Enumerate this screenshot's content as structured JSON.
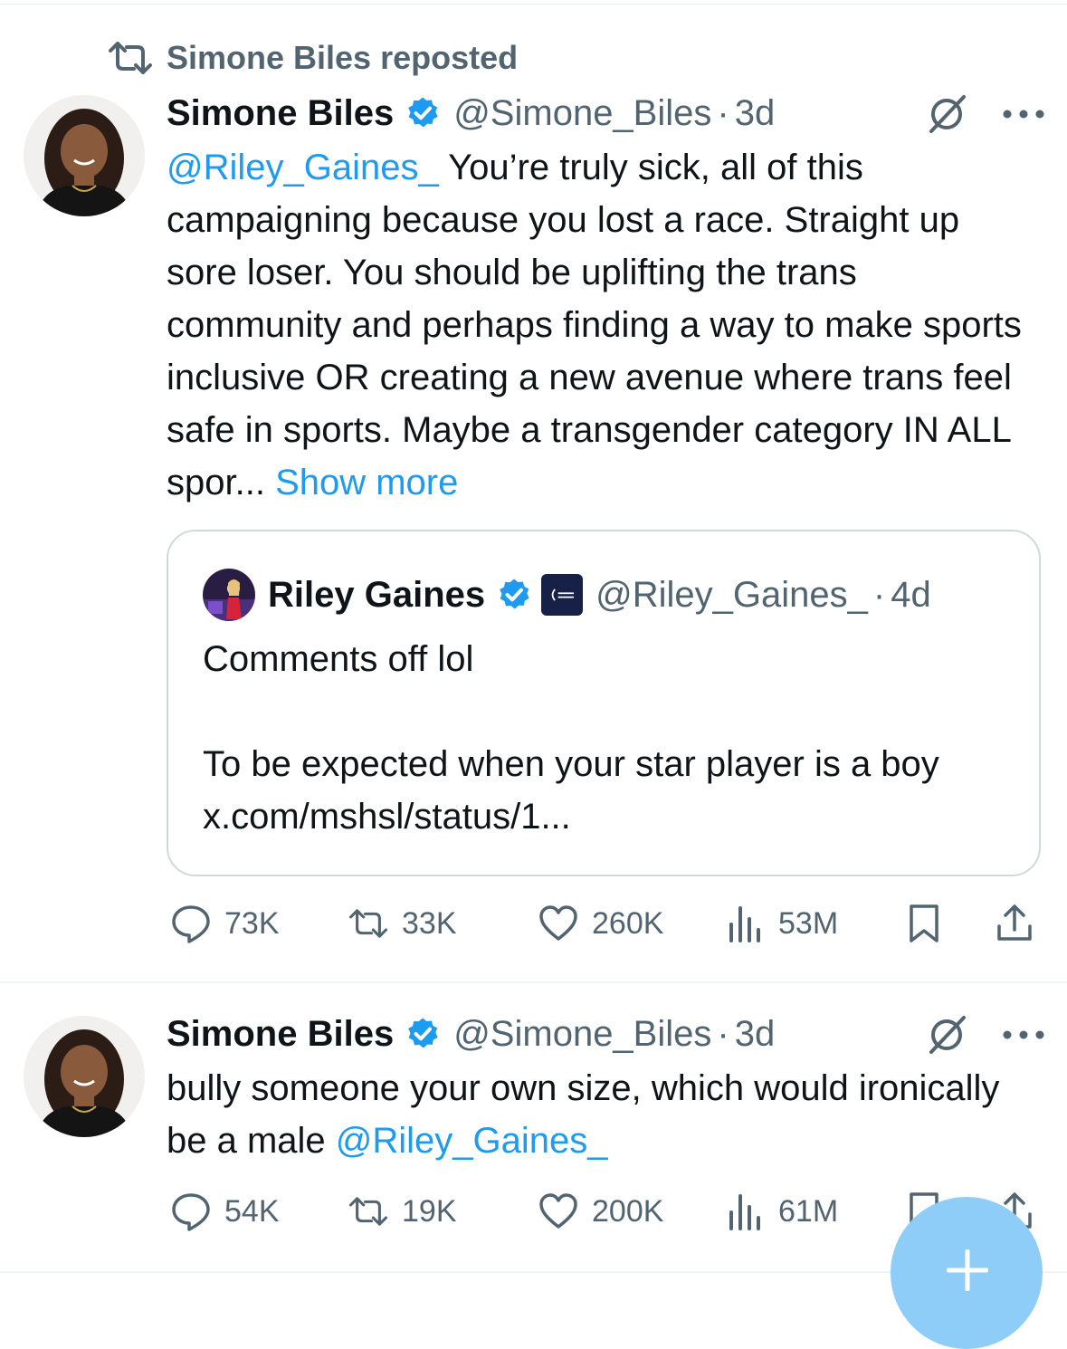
{
  "repost_banner": {
    "text": "Simone Biles reposted"
  },
  "tweets": [
    {
      "author_name": "Simone Biles",
      "handle": "@Simone_Biles",
      "separator": "·",
      "time": "3d",
      "text_mention": "@Riley_Gaines_",
      "text_body": " You’re truly sick, all of this campaigning because you lost a race. Straight up sore loser. You should be uplifting the trans community and perhaps finding a way to make sports inclusive OR creating a new avenue where trans feel safe in sports. Maybe a transgender category IN ALL spor... ",
      "show_more": "Show more",
      "quote": {
        "author_name": "Riley Gaines",
        "handle": "@Riley_Gaines_",
        "separator": "·",
        "time": "4d",
        "line1": "Comments off lol",
        "line2_prefix": "To be expected when your star player is a boy ",
        "line2_link": "x.com/mshsl/status/1..."
      },
      "stats": {
        "replies": "73K",
        "reposts": "33K",
        "likes": "260K",
        "views": "53M"
      }
    },
    {
      "author_name": "Simone Biles",
      "handle": "@Simone_Biles",
      "separator": "·",
      "time": "3d",
      "text_body": "bully someone your own size, which would ironically be a male ",
      "text_mention": "@Riley_Gaines_",
      "stats": {
        "replies": "54K",
        "reposts": "19K",
        "likes": "200K",
        "views": "61M"
      }
    }
  ],
  "icons": {
    "repost": "repost-icon",
    "verified": "verified-badge-icon",
    "grok": "grok-icon",
    "more": "more-options-icon",
    "reply": "reply-icon",
    "like": "heart-icon",
    "views": "views-icon",
    "bookmark": "bookmark-icon",
    "share": "share-icon",
    "compose": "compose-plus-icon"
  },
  "colors": {
    "link": "#1d9bf0",
    "muted": "#536471",
    "verified": "#1d9bf0",
    "fab": "#8ecdf8"
  }
}
